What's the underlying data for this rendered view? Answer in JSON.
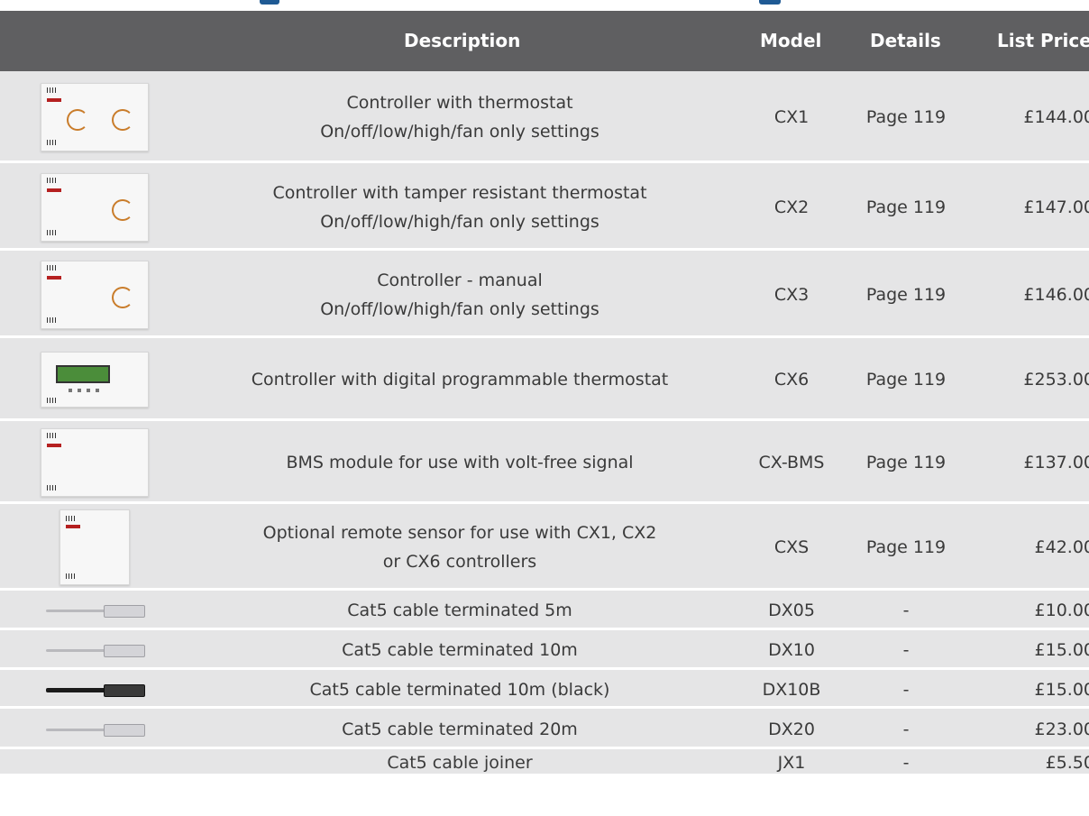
{
  "colors": {
    "header_bg": "#5f5f61",
    "header_text": "#ffffff",
    "row_bg": "#e5e5e6",
    "text": "#3a3a3a",
    "title_accent": "#1f5a94"
  },
  "table": {
    "headers": {
      "description": "Description",
      "model": "Model",
      "details": "Details",
      "price": "List Price"
    },
    "rows": [
      {
        "image": "thermostat-controller-image",
        "desc1": "Controller with thermostat",
        "desc2": "On/off/low/high/fan only settings",
        "model": "CX1",
        "details": "Page 119",
        "price": "£144.00"
      },
      {
        "image": "tamper-controller-image",
        "desc1": "Controller with tamper resistant thermostat",
        "desc2": "On/off/low/high/fan only settings",
        "model": "CX2",
        "details": "Page 119",
        "price": "£147.00"
      },
      {
        "image": "manual-controller-image",
        "desc1": "Controller - manual",
        "desc2": "On/off/low/high/fan only settings",
        "model": "CX3",
        "details": "Page 119",
        "price": "£146.00"
      },
      {
        "image": "digital-controller-image",
        "desc1": "Controller with digital programmable thermostat",
        "desc2": "",
        "model": "CX6",
        "details": "Page 119",
        "price": "£253.00"
      },
      {
        "image": "bms-module-image",
        "desc1": "BMS module for use with volt-free signal",
        "desc2": "",
        "model": "CX-BMS",
        "details": "Page 119",
        "price": "£137.00"
      },
      {
        "image": "remote-sensor-image",
        "desc1": "Optional remote sensor for use with CX1, CX2",
        "desc2": "or CX6 controllers",
        "model": "CXS",
        "details": "Page 119",
        "price": "£42.00"
      },
      {
        "image": "cable-image",
        "desc1": "Cat5 cable terminated 5m",
        "desc2": "",
        "model": "DX05",
        "details": "-",
        "price": "£10.00"
      },
      {
        "image": "cable-image",
        "desc1": "Cat5 cable terminated 10m",
        "desc2": "",
        "model": "DX10",
        "details": "-",
        "price": "£15.00"
      },
      {
        "image": "black-cable-image",
        "desc1": "Cat5 cable terminated 10m (black)",
        "desc2": "",
        "model": "DX10B",
        "details": "-",
        "price": "£15.00"
      },
      {
        "image": "cable-image",
        "desc1": "Cat5 cable terminated 20m",
        "desc2": "",
        "model": "DX20",
        "details": "-",
        "price": "£23.00"
      },
      {
        "image": "",
        "desc1": "Cat5 cable joiner",
        "desc2": "",
        "model": "JX1",
        "details": "-",
        "price": "£5.50"
      }
    ]
  }
}
